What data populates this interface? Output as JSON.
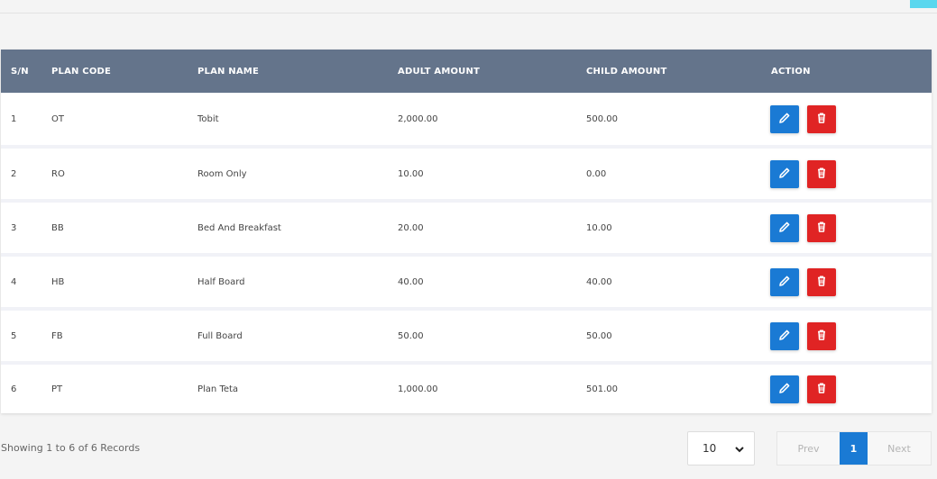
{
  "table": {
    "headers": [
      "S/N",
      "PLAN CODE",
      "PLAN NAME",
      "ADULT AMOUNT",
      "CHILD AMOUNT",
      "ACTION"
    ],
    "rows": [
      {
        "sn": "1",
        "code": "OT",
        "name": "Tobit",
        "adult": "2,000.00",
        "child": "500.00"
      },
      {
        "sn": "2",
        "code": "RO",
        "name": "Room Only",
        "adult": "10.00",
        "child": "0.00"
      },
      {
        "sn": "3",
        "code": "BB",
        "name": "Bed And Breakfast",
        "adult": "20.00",
        "child": "10.00"
      },
      {
        "sn": "4",
        "code": "HB",
        "name": "Half Board",
        "adult": "40.00",
        "child": "40.00"
      },
      {
        "sn": "5",
        "code": "FB",
        "name": "Full Board",
        "adult": "50.00",
        "child": "50.00"
      },
      {
        "sn": "6",
        "code": "PT",
        "name": "Plan Teta",
        "adult": "1,000.00",
        "child": "501.00"
      }
    ],
    "action_icons": {
      "edit": "pencil-icon",
      "delete": "trash-icon"
    }
  },
  "footer": {
    "info": "Showing 1 to 6 of 6 Records",
    "page_size": "10",
    "prev": "Prev",
    "current_page": "1",
    "next": "Next"
  },
  "colors": {
    "header_bg": "#64748b",
    "edit": "#1a7ad4",
    "delete": "#e02424",
    "accent": "#5ad7ee"
  }
}
